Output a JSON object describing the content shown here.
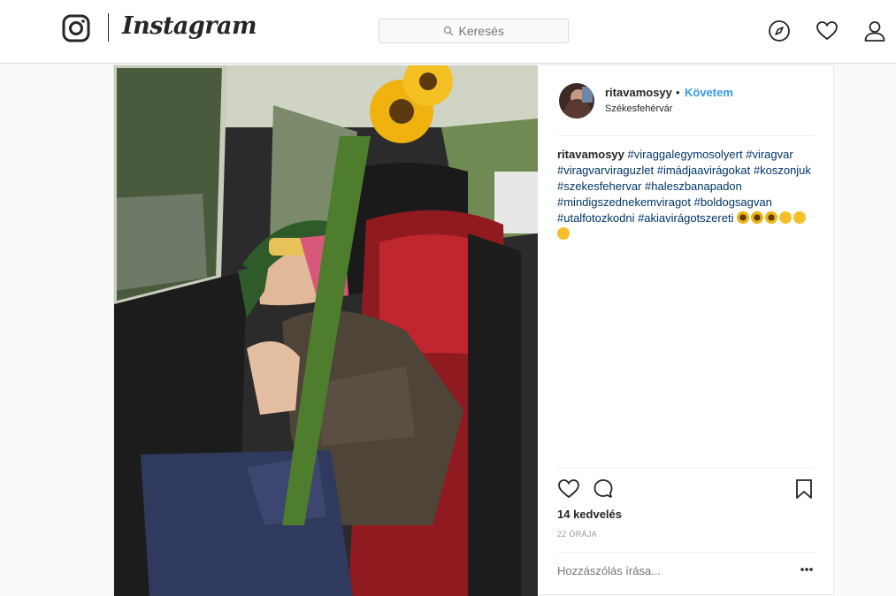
{
  "header": {
    "wordmark": "Instagram",
    "search": {
      "placeholder": "Keresés"
    }
  },
  "post": {
    "author": {
      "username": "ritavamosyy",
      "separator": "•",
      "follow_label": "Követem",
      "location": "Székesfehérvár"
    },
    "caption": {
      "username": "ritavamosyy",
      "hashtags": [
        "#viraggalegymosolyert",
        "#viragvar",
        "#viragvarviraguzlet",
        "#imádjaavirágokat",
        "#koszonjuk",
        "#szekesfehervar",
        "#haleszbanapadon",
        "#mindigszednekemviragot",
        "#boldogsagvan",
        "#utalfotozkodni",
        "#akiavirágotszereti"
      ],
      "emojis": [
        "sunflower-emoji",
        "sunflower-emoji",
        "sunflower-emoji",
        "smile-emoji",
        "slight-smile-emoji",
        "hug-emoji"
      ]
    },
    "likes": "14 kedvelés",
    "time": "22 ÓRÁJA",
    "comment": {
      "placeholder": "Hozzászólás írása..."
    }
  },
  "colors": {
    "link": "#3897f0",
    "hashtag": "#003569",
    "border": "#dbdbdb",
    "text": "#262626"
  }
}
